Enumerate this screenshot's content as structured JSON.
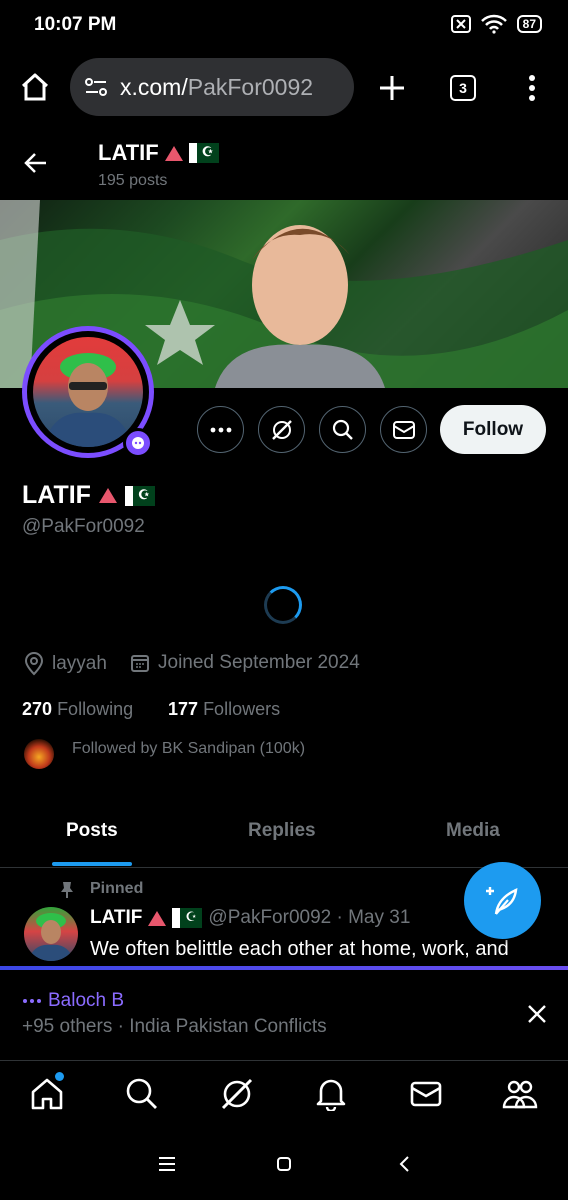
{
  "status_bar": {
    "time": "10:07 PM",
    "battery": "87"
  },
  "browser": {
    "url_domain": "x.com/",
    "url_path": "PakFor0092",
    "tab_count": "3"
  },
  "header": {
    "name": "LATIF",
    "posts_count": "195 posts"
  },
  "profile": {
    "name": "LATIF",
    "handle": "@PakFor0092",
    "location": "layyah",
    "joined": "Joined September 2024",
    "following_count": "270",
    "following_label": "Following",
    "followers_count": "177",
    "followers_label": "Followers",
    "followed_by": "Followed by BK Sandipan (100k)"
  },
  "actions": {
    "follow_label": "Follow"
  },
  "tabs": [
    {
      "label": "Posts",
      "active": true
    },
    {
      "label": "Replies",
      "active": false
    },
    {
      "label": "Media",
      "active": false
    }
  ],
  "pinned_post": {
    "pinned_label": "Pinned",
    "name": "LATIF",
    "handle_date": "@PakFor0092 · May 31",
    "text": "We often belittle each other at home, work, and"
  },
  "notification": {
    "title": "Baloch B",
    "subtitle": "+95 others · India Pakistan Conflicts"
  },
  "colors": {
    "accent": "#1d9bf0",
    "badge": "#7b4dff",
    "flag_red": "#e8576d"
  }
}
